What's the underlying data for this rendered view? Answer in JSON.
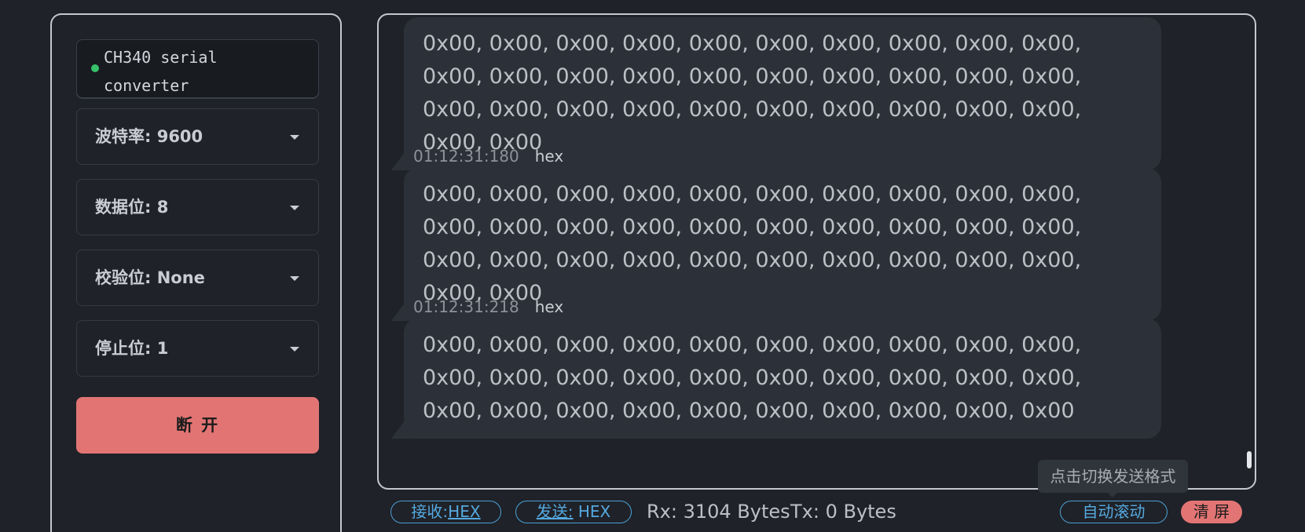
{
  "left_panel": {
    "device": {
      "name": "CH340 serial converter",
      "status_color": "#37c16a"
    },
    "baud_rate": "波特率: 9600",
    "data_bits": "数据位: 8",
    "parity": "校验位: None",
    "stop_bits": "停止位: 1",
    "disconnect_label": "断 开"
  },
  "messages": [
    {
      "time": "",
      "type": "",
      "body": "0x00, 0x00, 0x00, 0x00, 0x00, 0x00, 0x00, 0x00, 0x00, 0x00, 0x00, 0x00, 0x00, 0x00, 0x00, 0x00, 0x00, 0x00, 0x00, 0x00, 0x00, 0x00, 0x00, 0x00, 0x00, 0x00, 0x00, 0x00, 0x00, 0x00, 0x00, 0x00"
    },
    {
      "time": "01:12:31:180",
      "type": "hex",
      "body": "0x00, 0x00, 0x00, 0x00, 0x00, 0x00, 0x00, 0x00, 0x00, 0x00, 0x00, 0x00, 0x00, 0x00, 0x00, 0x00, 0x00, 0x00, 0x00, 0x00, 0x00, 0x00, 0x00, 0x00, 0x00, 0x00, 0x00, 0x00, 0x00, 0x00, 0x00, 0x00"
    },
    {
      "time": "01:12:31:218",
      "type": "hex",
      "body": "0x00, 0x00, 0x00, 0x00, 0x00, 0x00, 0x00, 0x00, 0x00, 0x00, 0x00, 0x00, 0x00, 0x00, 0x00, 0x00, 0x00, 0x00, 0x00, 0x00, 0x00, 0x00, 0x00, 0x00, 0x00, 0x00, 0x00, 0x00, 0x00, 0x00"
    }
  ],
  "tooltip": "点击切换发送格式",
  "status_bar": {
    "rx_format_label": "接收:",
    "rx_format_value": "HEX",
    "tx_format_label": "发送:",
    "tx_format_value": " HEX",
    "rx_count": "Rx: 3104 Bytes",
    "tx_count": "Tx: 0 Bytes",
    "auto_scroll_label": "自动滚动",
    "clear_label": "清 屏"
  },
  "colors": {
    "accent": "#4aa0d8",
    "danger": "#e27574",
    "bubble": "#2c3139"
  }
}
